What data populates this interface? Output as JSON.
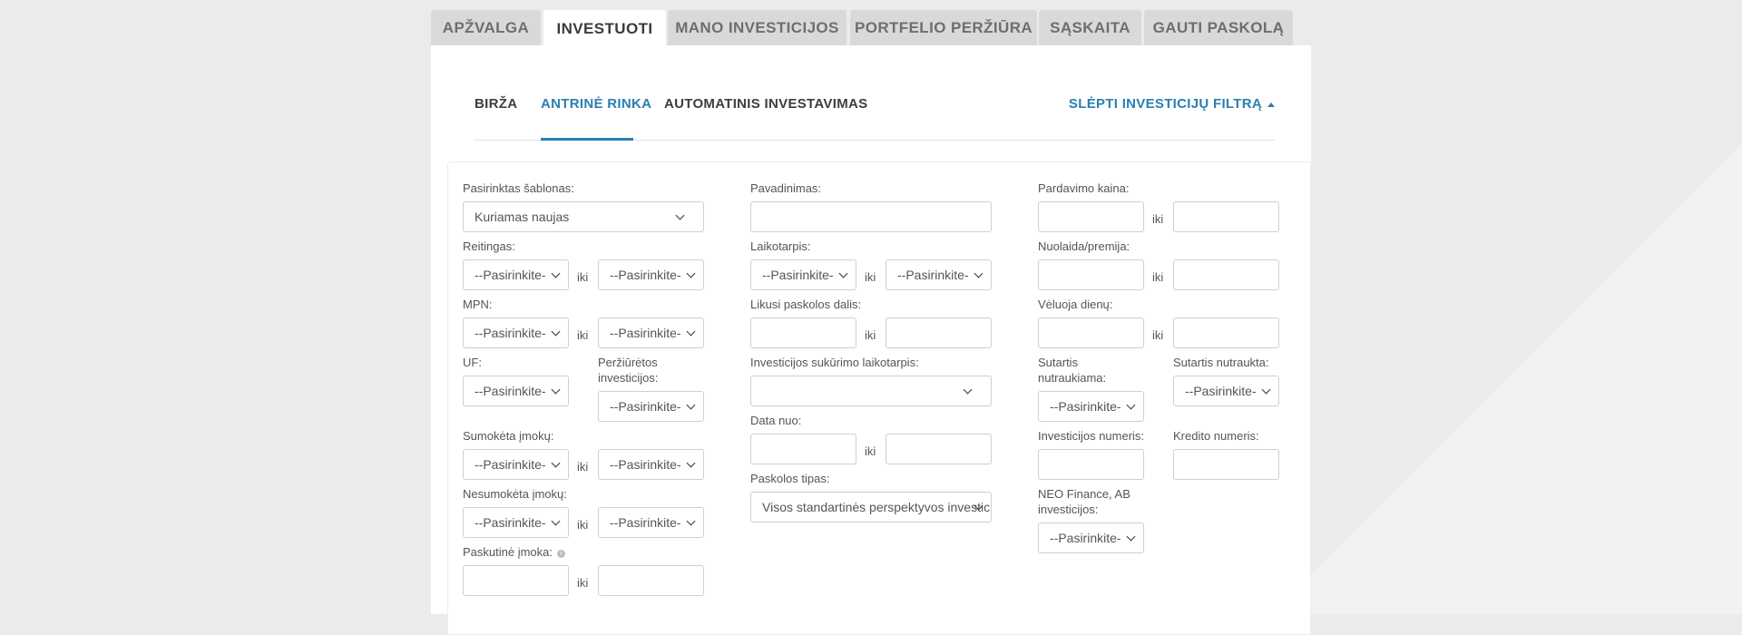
{
  "main_tabs": [
    "APŽVALGA",
    "INVESTUOTI",
    "MANO INVESTICIJOS",
    "PORTFELIO PERŽIŪRA",
    "SĄSKAITA",
    "GAUTI PASKOLĄ"
  ],
  "sub_tabs": [
    "BIRŽA",
    "ANTRINĖ RINKA",
    "AUTOMATINIS INVESTAVIMAS"
  ],
  "hide_filter_label": "SLĖPTI INVESTICIJŲ FILTRĄ",
  "iki": "iki",
  "select_placeholder": "--Pasirinkite-",
  "col1": {
    "template_label": "Pasirinktas šablonas:",
    "template_value": "Kuriamas naujas",
    "rating_label": "Reitingas:",
    "mpn_label": "MPN:",
    "uf_label": "UF:",
    "viewed_label": "Peržiūrėtos investicijos:",
    "paid_label": "Sumokėta įmokų:",
    "unpaid_label": "Nesumokėta įmokų:",
    "last_payment_label": "Paskutinė įmoka:"
  },
  "col2": {
    "name_label": "Pavadinimas:",
    "term_label": "Laikotarpis:",
    "remaining_label": "Likusi paskolos dalis:",
    "creation_label": "Investicijos sukūrimo laikotarpis:",
    "date_label": "Data nuo:",
    "loan_type_label": "Paskolos tipas:",
    "loan_type_value": "Visos standartinės perspektyvos investicijos"
  },
  "col3": {
    "price_label": "Pardavimo kaina:",
    "discount_label": "Nuolaida/premija:",
    "late_label": "Vėluoja dienų:",
    "terminating_label": "Sutartis nutraukiama:",
    "terminated_label": "Sutartis nutraukta:",
    "inv_number_label": "Investicijos numeris:",
    "credit_number_label": "Kredito numeris:",
    "neo_label": "NEO Finance, AB investicijos:"
  }
}
